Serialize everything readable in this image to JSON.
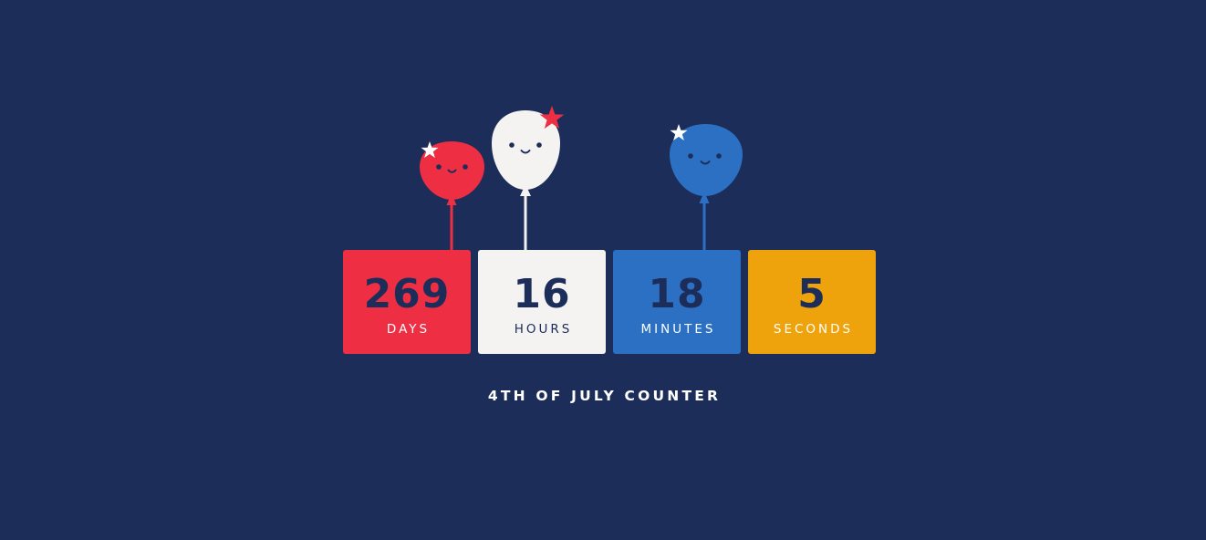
{
  "colors": {
    "background": "#1c2d5a",
    "red": "#ee2e42",
    "white": "#f4f3f2",
    "blue": "#2c70c4",
    "gold": "#eea20b"
  },
  "counter": {
    "days": {
      "value": "269",
      "label": "DAYS"
    },
    "hours": {
      "value": "16",
      "label": "HOURS"
    },
    "minutes": {
      "value": "18",
      "label": "MINUTES"
    },
    "seconds": {
      "value": "5",
      "label": "SECONDS"
    }
  },
  "decorations": {
    "balloons": [
      {
        "name": "red-balloon-icon",
        "color": "red",
        "attached_to": "days"
      },
      {
        "name": "white-balloon-icon",
        "color": "white",
        "attached_to": "hours"
      },
      {
        "name": "blue-balloon-icon",
        "color": "blue",
        "attached_to": "minutes"
      }
    ],
    "star_icon": "star-icon",
    "face_icon": "smiley-face-icon"
  },
  "title": "4TH OF JULY COUNTER"
}
